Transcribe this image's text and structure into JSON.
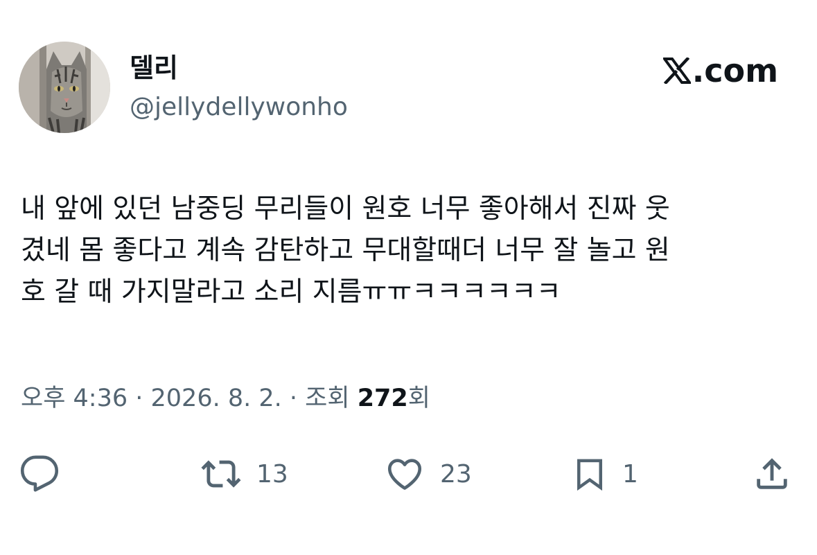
{
  "author": {
    "display_name": "델리",
    "handle": "@jellydellywonho",
    "avatar": "cat-avatar"
  },
  "brand": {
    "label": ".com",
    "icon": "x-logo-icon"
  },
  "tweet": {
    "text": "내 앞에 있던 남중딩 무리들이 원호 너무 좋아해서 진짜 웃\n겼네 몸 좋다고 계속 감탄하고 무대할때더 너무 잘 놀고 원\n호 갈 때 가지말라고 소리 지름ㅠㅠㅋㅋㅋㅋㅋㅋ"
  },
  "meta": {
    "time": "오후 4:36",
    "separator": " · ",
    "date": "2026. 8. 2.",
    "views_label": "조회 ",
    "views_count": "272",
    "views_suffix": "회"
  },
  "actions": {
    "reply": {
      "icon": "reply-icon",
      "count": ""
    },
    "repost": {
      "icon": "repost-icon",
      "count": "13"
    },
    "like": {
      "icon": "heart-icon",
      "count": "23"
    },
    "bookmark": {
      "icon": "bookmark-icon",
      "count": "1"
    },
    "share": {
      "icon": "share-icon",
      "count": ""
    }
  },
  "colors": {
    "text": "#0f1419",
    "secondary": "#536471",
    "background": "#ffffff"
  }
}
